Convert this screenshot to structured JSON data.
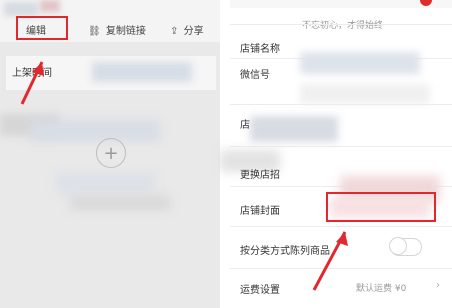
{
  "left": {
    "edit_label": "编辑",
    "copy_link_label": "复制链接",
    "share_label": "分享",
    "row_label": "上架时间"
  },
  "right": {
    "top_quote": "不忘初心，才得始终",
    "rows": [
      {
        "label": "店铺名称"
      },
      {
        "label": "微信号"
      },
      {
        "label": "店"
      },
      {
        "label": "更换店招"
      },
      {
        "label": "店铺封面"
      },
      {
        "label": "按分类方式陈列商品"
      },
      {
        "label": "运费设置",
        "value": "默认运费 ¥0"
      }
    ]
  },
  "icons": {
    "link": "link-icon",
    "share": "share-icon",
    "plus": "plus-circle-icon",
    "chevron": "chevron-right-icon"
  },
  "colors": {
    "annotation_red": "#e0282e"
  }
}
